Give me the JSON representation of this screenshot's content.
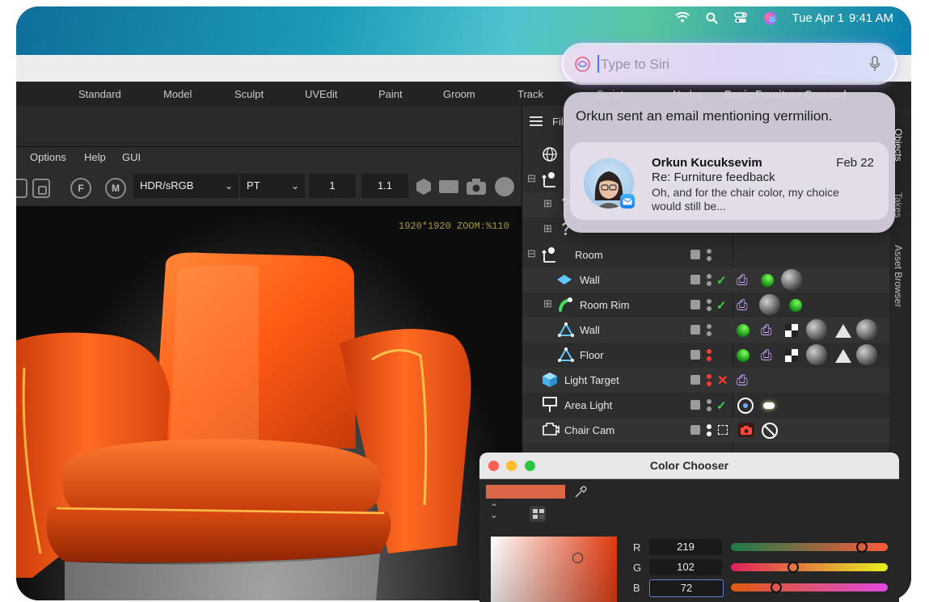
{
  "menubar": {
    "date": "Tue Apr 1",
    "time": "9:41 AM"
  },
  "tabs": [
    "Standard",
    "Model",
    "Sculpt",
    "UVEdit",
    "Paint",
    "Groom",
    "Track",
    "Script",
    "Nodes",
    "Basic Furniture Crossed"
  ],
  "menu": [
    "Options",
    "Help",
    "GUI"
  ],
  "toolbar": {
    "color_space": "HDR/sRGB",
    "view_transform": "PT",
    "value1": "1",
    "value2": "1.1",
    "round_f": "F",
    "round_m": "M"
  },
  "viewport": {
    "zoom_text": "1920*1920 ZOOM:%110"
  },
  "objects": {
    "header_label": "Fil",
    "rows": [
      {
        "name": "Room"
      },
      {
        "name": "Wall"
      },
      {
        "name": "Room Rim"
      },
      {
        "name": "Wall"
      },
      {
        "name": "Floor"
      },
      {
        "name": "Light Target"
      },
      {
        "name": "Area Light"
      },
      {
        "name": "Chair Cam"
      }
    ]
  },
  "side_tabs": [
    "Objects",
    "Takes",
    "Asset Browser"
  ],
  "siri": {
    "placeholder": "Type to Siri"
  },
  "notification": {
    "summary": "Orkun sent an email mentioning vermilion.",
    "sender": "Orkun Kucuksevim",
    "date": "Feb 22",
    "subject": "Re: Furniture feedback",
    "preview": "Oh, and for the chair color, my choice would still be..."
  },
  "color_chooser": {
    "title": "Color Chooser",
    "swatch_color": "#db6648",
    "channels": [
      {
        "label": "R",
        "value": "219"
      },
      {
        "label": "G",
        "value": "102"
      },
      {
        "label": "B",
        "value": "72"
      }
    ]
  },
  "colors": {
    "accent_orange": "#e0501e",
    "check_green": "#3cd24a",
    "error_red": "#ff3b30"
  }
}
